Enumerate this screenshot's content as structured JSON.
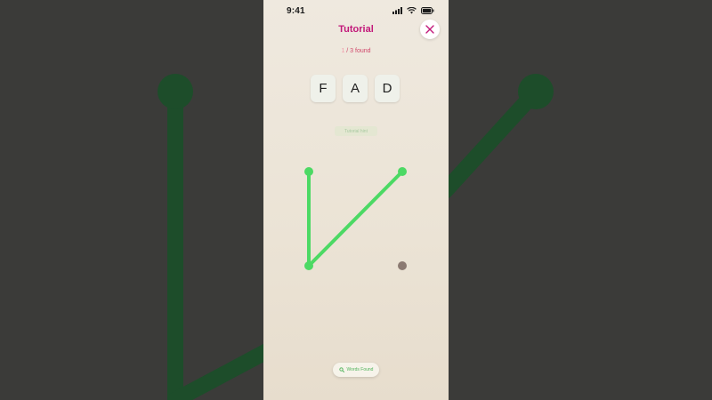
{
  "status_bar": {
    "time": "9:41"
  },
  "header": {
    "title": "Tutorial",
    "close_icon": "close-icon"
  },
  "progress": {
    "found_count": "1",
    "found_suffix": " / 3 found"
  },
  "word_tiles": [
    "F",
    "A",
    "D"
  ],
  "hint": {
    "label": "Tutorial hint"
  },
  "footer": {
    "words_found_label": "Words Found"
  },
  "colors": {
    "accent": "#c2187a",
    "path_green": "#4cd964",
    "echo_green": "#1d4d2a",
    "idle_node": "#8b7a72"
  }
}
